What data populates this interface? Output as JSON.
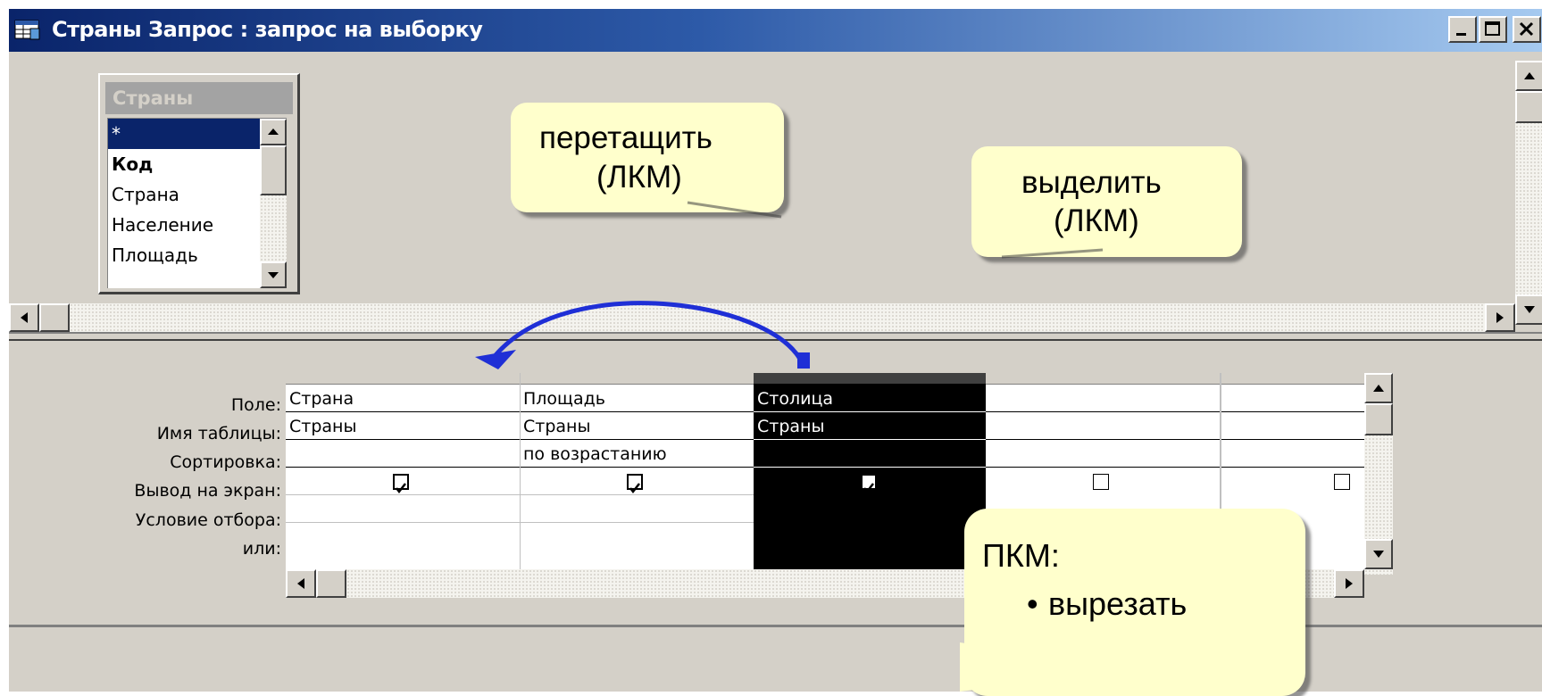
{
  "window": {
    "title": "Страны Запрос : запрос на выборку"
  },
  "field_list": {
    "table_name": "Страны",
    "items": [
      {
        "label": "*",
        "selected": true,
        "bold": false
      },
      {
        "label": "Код",
        "selected": false,
        "bold": true
      },
      {
        "label": "Страна",
        "selected": false,
        "bold": false
      },
      {
        "label": "Население",
        "selected": false,
        "bold": false
      },
      {
        "label": "Площадь",
        "selected": false,
        "bold": false
      }
    ]
  },
  "callouts": {
    "drag_line1": "перетащить",
    "drag_line2": "(ЛКМ)",
    "select_line1": "выделить",
    "select_line2": "(ЛКМ)",
    "context_title": "ПКМ:",
    "context_item1": "вырезать"
  },
  "grid": {
    "row_labels": {
      "field": "Поле:",
      "table": "Имя таблицы:",
      "sort": "Сортировка:",
      "show": "Вывод на экран:",
      "criteria": "Условие отбора:",
      "or": "или:"
    },
    "columns": [
      {
        "field": "Страна",
        "table": "Страны",
        "sort": "",
        "show": true,
        "selected": false
      },
      {
        "field": "Площадь",
        "table": "Страны",
        "sort": "по возрастанию",
        "show": true,
        "selected": false
      },
      {
        "field": "Столица",
        "table": "Страны",
        "sort": "",
        "show": true,
        "selected": true
      },
      {
        "field": "",
        "table": "",
        "sort": "",
        "show": false,
        "selected": false
      },
      {
        "field": "",
        "table": "",
        "sort": "",
        "show": false,
        "selected": false
      }
    ]
  },
  "colors": {
    "title_start": "#0a246a",
    "title_end": "#a6caf0",
    "window_face": "#d4d0c8",
    "callout_fill": "#ffffcc",
    "arrow": "#1f2fd6",
    "selection": "#000000"
  }
}
